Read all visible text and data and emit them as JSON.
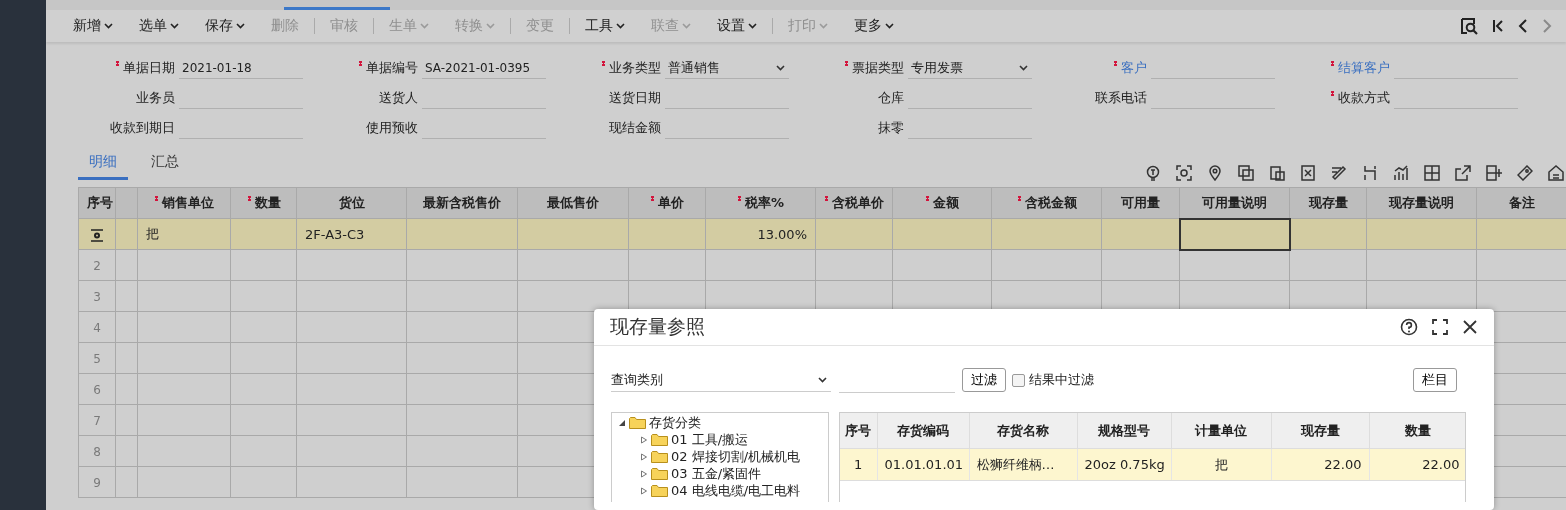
{
  "toolbar": {
    "items": [
      {
        "kind": "button",
        "label": "新增",
        "dropdown": true,
        "disabled": false
      },
      {
        "kind": "button",
        "label": "选单",
        "dropdown": true,
        "disabled": false
      },
      {
        "kind": "button",
        "label": "保存",
        "dropdown": true,
        "disabled": false
      },
      {
        "kind": "button",
        "label": "删除",
        "dropdown": false,
        "disabled": true
      },
      {
        "kind": "separator"
      },
      {
        "kind": "button",
        "label": "审核",
        "dropdown": false,
        "disabled": true
      },
      {
        "kind": "separator"
      },
      {
        "kind": "button",
        "label": "生单",
        "dropdown": true,
        "disabled": true
      },
      {
        "kind": "button",
        "label": "转换",
        "dropdown": true,
        "disabled": true
      },
      {
        "kind": "separator"
      },
      {
        "kind": "button",
        "label": "变更",
        "dropdown": false,
        "disabled": true
      },
      {
        "kind": "separator"
      },
      {
        "kind": "button",
        "label": "工具",
        "dropdown": true,
        "disabled": false
      },
      {
        "kind": "button",
        "label": "联查",
        "dropdown": true,
        "disabled": true
      },
      {
        "kind": "button",
        "label": "设置",
        "dropdown": true,
        "disabled": false
      },
      {
        "kind": "separator"
      },
      {
        "kind": "button",
        "label": "打印",
        "dropdown": true,
        "disabled": true
      },
      {
        "kind": "button",
        "label": "更多",
        "dropdown": true,
        "disabled": false
      }
    ]
  },
  "form": {
    "rows": [
      [
        {
          "label": "单据日期",
          "required": true,
          "link": false,
          "kind": "text",
          "value": "2021-01-18"
        },
        {
          "label": "单据编号",
          "required": true,
          "link": false,
          "kind": "text",
          "value": "SA-2021-01-0395"
        },
        {
          "label": "业务类型",
          "required": true,
          "link": false,
          "kind": "select",
          "value": "普通销售"
        },
        {
          "label": "票据类型",
          "required": true,
          "link": false,
          "kind": "select",
          "value": "专用发票"
        },
        {
          "label": "客户",
          "required": true,
          "link": true,
          "kind": "text"
        },
        {
          "label": "结算客户",
          "required": true,
          "link": true,
          "kind": "text"
        }
      ],
      [
        {
          "label": "业务员",
          "required": false,
          "link": false,
          "kind": "text"
        },
        {
          "label": "送货人",
          "required": false,
          "link": false,
          "kind": "text"
        },
        {
          "label": "送货日期",
          "required": false,
          "link": false,
          "kind": "text"
        },
        {
          "label": "仓库",
          "required": false,
          "link": false,
          "kind": "text"
        },
        {
          "label": "联系电话",
          "required": false,
          "link": false,
          "kind": "text"
        },
        {
          "label": "收款方式",
          "required": true,
          "link": false,
          "kind": "text"
        }
      ],
      [
        {
          "label": "收款到期日",
          "required": false,
          "link": false,
          "kind": "text"
        },
        {
          "label": "使用预收",
          "required": false,
          "link": false,
          "kind": "text"
        },
        {
          "label": "现结金额",
          "required": false,
          "link": false,
          "kind": "text"
        },
        {
          "label": "抹零",
          "required": false,
          "link": false,
          "kind": "text"
        }
      ]
    ]
  },
  "detail_tabs": [
    {
      "label": "明细",
      "selected": true
    },
    {
      "label": "汇总",
      "selected": false
    }
  ],
  "table": {
    "columns": [
      {
        "label": "序号",
        "required": false
      },
      {
        "required": false
      },
      {
        "label": "销售单位",
        "required": true
      },
      {
        "label": "数量",
        "required": true
      },
      {
        "label": "货位",
        "required": false
      },
      {
        "label": "最新含税售价",
        "required": false
      },
      {
        "label": "最低售价",
        "required": false
      },
      {
        "label": "单价",
        "required": true
      },
      {
        "label": "税率%",
        "required": true
      },
      {
        "label": "含税单价",
        "required": true
      },
      {
        "label": "金额",
        "required": true
      },
      {
        "label": "含税金额",
        "required": true
      },
      {
        "label": "可用量",
        "required": false
      },
      {
        "label": "可用量说明",
        "required": false
      },
      {
        "label": "现存量",
        "required": false
      },
      {
        "label": "现存量说明",
        "required": false
      },
      {
        "label": "备注",
        "required": false
      }
    ],
    "rows": [
      {
        "kind": "current",
        "selected": true,
        "cells": [
          {
            "focused": false
          },
          {
            "text": "把",
            "focused": false
          },
          {
            "focused": false
          },
          {
            "text": "2F-A3-C3",
            "focused": false
          },
          {
            "focused": false
          },
          {
            "focused": false
          },
          {
            "focused": false
          },
          {
            "text": "13.00%",
            "focused": false
          },
          {
            "focused": false
          },
          {
            "focused": false
          },
          {
            "focused": false
          },
          {
            "focused": false
          },
          {
            "focused": true
          },
          {
            "focused": false
          },
          {
            "focused": false
          },
          {
            "focused": false
          }
        ]
      },
      {
        "kind": "blank",
        "number": "2",
        "selected": false
      },
      {
        "kind": "blank",
        "number": "3",
        "selected": false
      },
      {
        "kind": "blank",
        "number": "4",
        "selected": false
      },
      {
        "kind": "blank",
        "number": "5",
        "selected": false
      },
      {
        "kind": "blank",
        "number": "6",
        "selected": false
      },
      {
        "kind": "blank",
        "number": "7",
        "selected": false
      },
      {
        "kind": "blank",
        "number": "8",
        "selected": false
      },
      {
        "kind": "blank",
        "number": "9",
        "selected": false
      }
    ]
  },
  "dialog": {
    "title": "现存量参照",
    "query_select": "查询类别",
    "filter_button": "过滤",
    "filter_in_results": {
      "label": "结果中过滤",
      "checked": false
    },
    "columns_button": "栏目",
    "tree": [
      {
        "label": "存货分类",
        "expanded": true,
        "children": [
          {
            "label": "01 工具/搬运",
            "expanded": false
          },
          {
            "label": "02 焊接切割/机械机电",
            "expanded": false
          },
          {
            "label": "03 五金/紧固件",
            "expanded": false
          },
          {
            "label": "04 电线电缆/电工电料",
            "expanded": false
          }
        ]
      }
    ],
    "grid": {
      "columns": [
        "序号",
        "存货编码",
        "存货名称",
        "规格型号",
        "计量单位",
        "现存量",
        "数量"
      ],
      "rows": [
        {
          "selected": true,
          "cells": [
            "1",
            "01.01.01.01",
            "松狮纤维柄…",
            "20oz 0.75kg",
            "把",
            "22.00",
            "22.00"
          ]
        }
      ]
    }
  }
}
